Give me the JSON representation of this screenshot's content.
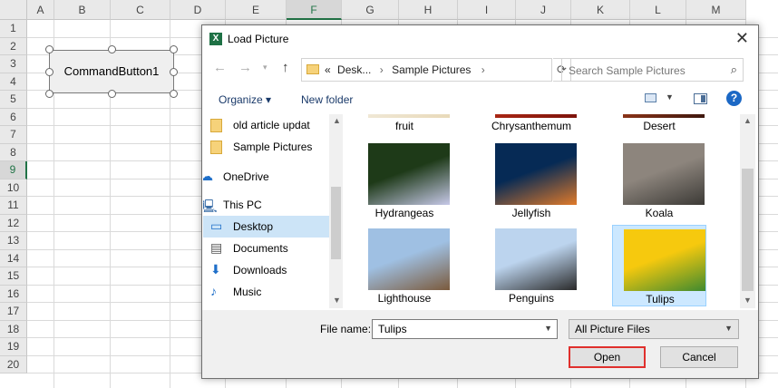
{
  "sheet": {
    "columns": [
      "A",
      "B",
      "C",
      "D",
      "E",
      "F",
      "G",
      "H",
      "I",
      "J",
      "K",
      "L",
      "M"
    ],
    "selected_column": "F",
    "rows": [
      "1",
      "2",
      "3",
      "4",
      "5",
      "6",
      "7",
      "8",
      "9",
      "10",
      "11",
      "12",
      "13",
      "14",
      "15",
      "16",
      "17",
      "18",
      "19",
      "20"
    ],
    "selected_row": "9",
    "command_button_label": "CommandButton1"
  },
  "dialog": {
    "title": "Load Picture",
    "close_glyph": "✕",
    "address": {
      "prefix": "«",
      "segments": [
        "Desk...",
        "Sample Pictures"
      ],
      "separator": "›"
    },
    "search_placeholder": "Search Sample Pictures",
    "toolbar": {
      "organize_label": "Organize ▾",
      "new_folder_label": "New folder",
      "help_glyph": "?"
    },
    "nav_items": [
      {
        "label": "old article updat",
        "icon": "folder-icon",
        "selected": false
      },
      {
        "label": "Sample Pictures",
        "icon": "folder-icon",
        "selected": false
      },
      {
        "label": "OneDrive",
        "icon": "cloud-icon",
        "selected": false
      },
      {
        "label": "This PC",
        "icon": "computer-icon",
        "selected": false
      },
      {
        "label": "Desktop",
        "icon": "desktop-icon",
        "selected": true
      },
      {
        "label": "Documents",
        "icon": "document-icon",
        "selected": false
      },
      {
        "label": "Downloads",
        "icon": "download-icon",
        "selected": false
      },
      {
        "label": "Music",
        "icon": "music-icon",
        "selected": false
      }
    ],
    "files": [
      {
        "name": "fruit",
        "selected": false,
        "colors": [
          "#f4f0e6",
          "#e8d9b8"
        ]
      },
      {
        "name": "Chrysanthemum",
        "selected": false,
        "colors": [
          "#c4321a",
          "#7a120a"
        ]
      },
      {
        "name": "Desert",
        "selected": false,
        "colors": [
          "#b9441f",
          "#3a160d"
        ]
      },
      {
        "name": "Hydrangeas",
        "selected": false,
        "colors": [
          "#1e3a18",
          "#c7c9e8"
        ]
      },
      {
        "name": "Jellyfish",
        "selected": false,
        "colors": [
          "#062a55",
          "#e07a2a"
        ]
      },
      {
        "name": "Koala",
        "selected": false,
        "colors": [
          "#8d857d",
          "#3c3a36"
        ]
      },
      {
        "name": "Lighthouse",
        "selected": false,
        "colors": [
          "#9fc0e3",
          "#7b5a3c"
        ]
      },
      {
        "name": "Penguins",
        "selected": false,
        "colors": [
          "#bcd4ee",
          "#2a2a2a"
        ]
      },
      {
        "name": "Tulips",
        "selected": true,
        "colors": [
          "#f6c90e",
          "#3f8a2f"
        ]
      }
    ],
    "filename_label": "File name:",
    "filename_value": "Tulips",
    "filter_value": "All Picture Files",
    "open_label": "Open",
    "cancel_label": "Cancel"
  }
}
